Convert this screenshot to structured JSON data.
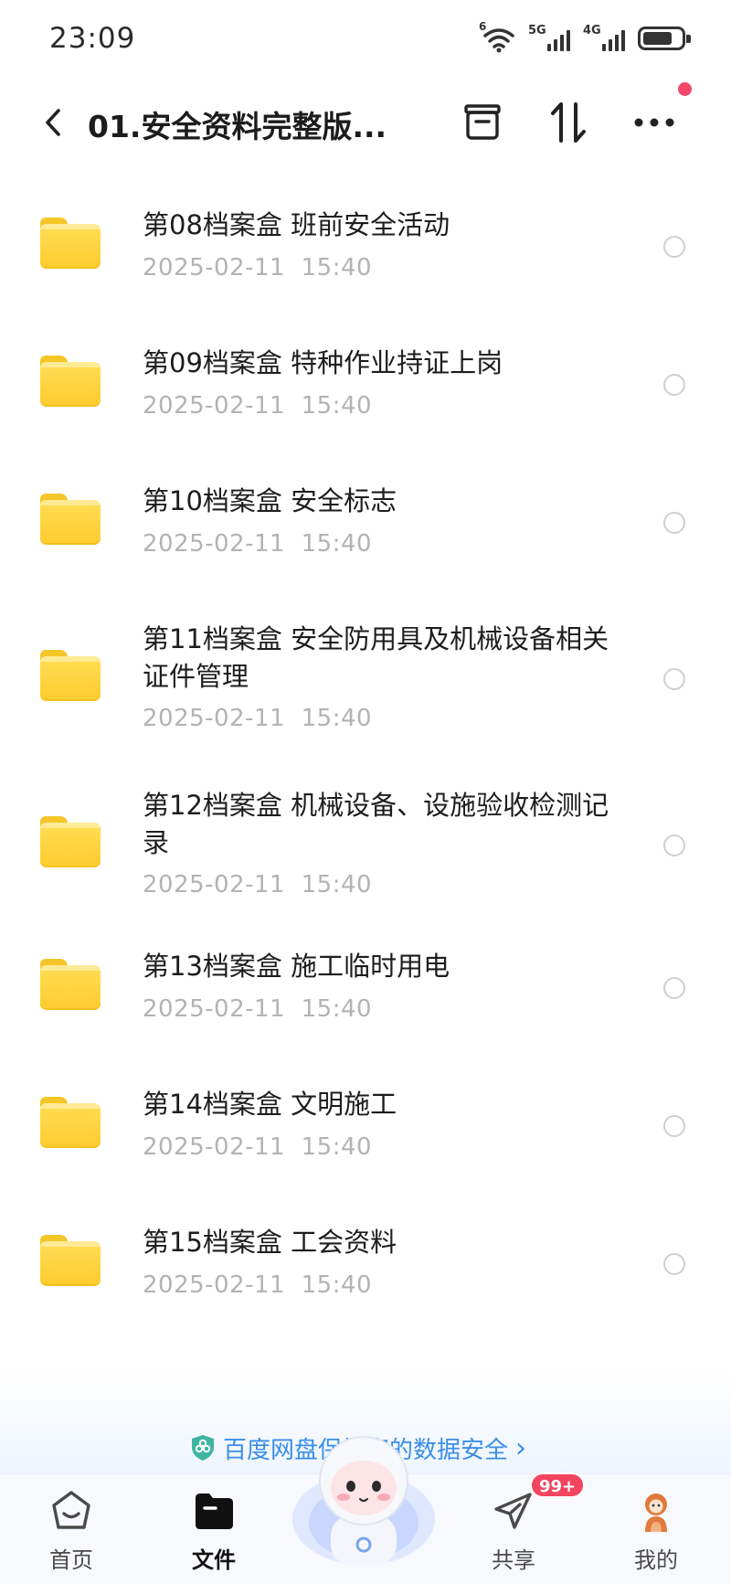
{
  "status_bar": {
    "time": "23:09",
    "network_1": "5G",
    "network_2": "4G",
    "wifi_label": "6"
  },
  "header": {
    "title": "01.安全资料完整版...",
    "icons": [
      "back-icon",
      "archive-icon",
      "sort-icon",
      "more-icon"
    ]
  },
  "files": [
    {
      "name": "第08档案盒 班前安全活动",
      "date": "2025-02-11  15:40"
    },
    {
      "name": "第09档案盒 特种作业持证上岗",
      "date": "2025-02-11  15:40"
    },
    {
      "name": "第10档案盒 安全标志",
      "date": "2025-02-11  15:40"
    },
    {
      "name": "第11档案盒 安全防用具及机械设备相关证件管理",
      "date": "2025-02-11  15:40"
    },
    {
      "name": "第12档案盒 机械设备、设施验收检测记录",
      "date": "2025-02-11  15:40"
    },
    {
      "name": "第13档案盒 施工临时用电",
      "date": "2025-02-11  15:40"
    },
    {
      "name": "第14档案盒 文明施工",
      "date": "2025-02-11  15:40"
    },
    {
      "name": "第15档案盒 工会资料",
      "date": "2025-02-11  15:40"
    }
  ],
  "promo": {
    "text": "百度网盘保护您的数据安全",
    "chevron": "›"
  },
  "tabbar": {
    "home": "首页",
    "files": "文件",
    "share": "共享",
    "mine": "我的",
    "share_badge": "99+"
  },
  "colors": {
    "folder": "#ffcc2e",
    "badge": "#f3455f",
    "promo": "#3a8ee6",
    "notif_dot": "#f4476b"
  }
}
